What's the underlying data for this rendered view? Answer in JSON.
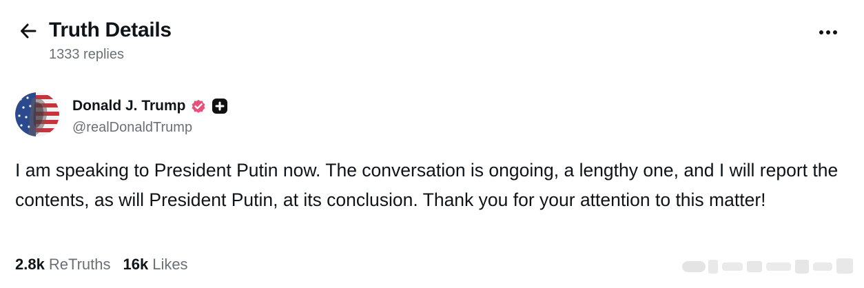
{
  "header": {
    "back_icon": "arrow-left-icon",
    "title": "Truth Details",
    "replies": "1333 replies",
    "more_icon": "more-horizontal-icon"
  },
  "post": {
    "author": {
      "name": "Donald J. Trump",
      "handle": "@realDonaldTrump",
      "verified_icon": "verified-badge-icon",
      "verified_color": "#e8527a",
      "plus_icon": "plus-badge-icon"
    },
    "text": "I am speaking to President Putin now. The conversation is ongoing, a lengthy one, and I will report the contents, as will President Putin, at its conclusion. Thank you for your attention to this matter!",
    "stats": {
      "retruths_count": "2.8k",
      "retruths_label": "ReTruths",
      "likes_count": "16k",
      "likes_label": "Likes"
    }
  },
  "colors": {
    "text_primary": "#0f1419",
    "text_secondary": "#6b6f76",
    "background": "#ffffff"
  }
}
